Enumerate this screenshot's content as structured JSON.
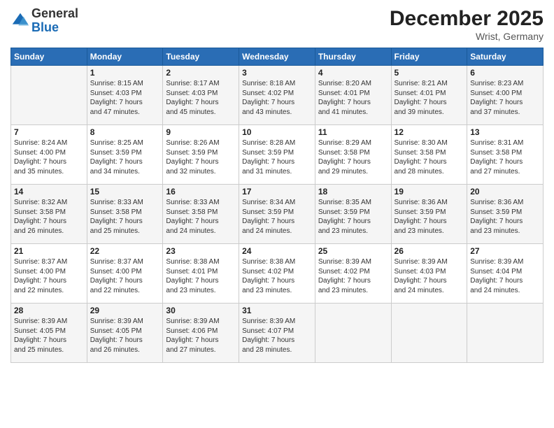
{
  "header": {
    "logo": {
      "general": "General",
      "blue": "Blue"
    },
    "title": "December 2025",
    "location": "Wrist, Germany"
  },
  "weekdays": [
    "Sunday",
    "Monday",
    "Tuesday",
    "Wednesday",
    "Thursday",
    "Friday",
    "Saturday"
  ],
  "weeks": [
    [
      {
        "day": "",
        "info": ""
      },
      {
        "day": "1",
        "info": "Sunrise: 8:15 AM\nSunset: 4:03 PM\nDaylight: 7 hours\nand 47 minutes."
      },
      {
        "day": "2",
        "info": "Sunrise: 8:17 AM\nSunset: 4:03 PM\nDaylight: 7 hours\nand 45 minutes."
      },
      {
        "day": "3",
        "info": "Sunrise: 8:18 AM\nSunset: 4:02 PM\nDaylight: 7 hours\nand 43 minutes."
      },
      {
        "day": "4",
        "info": "Sunrise: 8:20 AM\nSunset: 4:01 PM\nDaylight: 7 hours\nand 41 minutes."
      },
      {
        "day": "5",
        "info": "Sunrise: 8:21 AM\nSunset: 4:01 PM\nDaylight: 7 hours\nand 39 minutes."
      },
      {
        "day": "6",
        "info": "Sunrise: 8:23 AM\nSunset: 4:00 PM\nDaylight: 7 hours\nand 37 minutes."
      }
    ],
    [
      {
        "day": "7",
        "info": "Sunrise: 8:24 AM\nSunset: 4:00 PM\nDaylight: 7 hours\nand 35 minutes."
      },
      {
        "day": "8",
        "info": "Sunrise: 8:25 AM\nSunset: 3:59 PM\nDaylight: 7 hours\nand 34 minutes."
      },
      {
        "day": "9",
        "info": "Sunrise: 8:26 AM\nSunset: 3:59 PM\nDaylight: 7 hours\nand 32 minutes."
      },
      {
        "day": "10",
        "info": "Sunrise: 8:28 AM\nSunset: 3:59 PM\nDaylight: 7 hours\nand 31 minutes."
      },
      {
        "day": "11",
        "info": "Sunrise: 8:29 AM\nSunset: 3:58 PM\nDaylight: 7 hours\nand 29 minutes."
      },
      {
        "day": "12",
        "info": "Sunrise: 8:30 AM\nSunset: 3:58 PM\nDaylight: 7 hours\nand 28 minutes."
      },
      {
        "day": "13",
        "info": "Sunrise: 8:31 AM\nSunset: 3:58 PM\nDaylight: 7 hours\nand 27 minutes."
      }
    ],
    [
      {
        "day": "14",
        "info": "Sunrise: 8:32 AM\nSunset: 3:58 PM\nDaylight: 7 hours\nand 26 minutes."
      },
      {
        "day": "15",
        "info": "Sunrise: 8:33 AM\nSunset: 3:58 PM\nDaylight: 7 hours\nand 25 minutes."
      },
      {
        "day": "16",
        "info": "Sunrise: 8:33 AM\nSunset: 3:58 PM\nDaylight: 7 hours\nand 24 minutes."
      },
      {
        "day": "17",
        "info": "Sunrise: 8:34 AM\nSunset: 3:59 PM\nDaylight: 7 hours\nand 24 minutes."
      },
      {
        "day": "18",
        "info": "Sunrise: 8:35 AM\nSunset: 3:59 PM\nDaylight: 7 hours\nand 23 minutes."
      },
      {
        "day": "19",
        "info": "Sunrise: 8:36 AM\nSunset: 3:59 PM\nDaylight: 7 hours\nand 23 minutes."
      },
      {
        "day": "20",
        "info": "Sunrise: 8:36 AM\nSunset: 3:59 PM\nDaylight: 7 hours\nand 23 minutes."
      }
    ],
    [
      {
        "day": "21",
        "info": "Sunrise: 8:37 AM\nSunset: 4:00 PM\nDaylight: 7 hours\nand 22 minutes."
      },
      {
        "day": "22",
        "info": "Sunrise: 8:37 AM\nSunset: 4:00 PM\nDaylight: 7 hours\nand 22 minutes."
      },
      {
        "day": "23",
        "info": "Sunrise: 8:38 AM\nSunset: 4:01 PM\nDaylight: 7 hours\nand 23 minutes."
      },
      {
        "day": "24",
        "info": "Sunrise: 8:38 AM\nSunset: 4:02 PM\nDaylight: 7 hours\nand 23 minutes."
      },
      {
        "day": "25",
        "info": "Sunrise: 8:39 AM\nSunset: 4:02 PM\nDaylight: 7 hours\nand 23 minutes."
      },
      {
        "day": "26",
        "info": "Sunrise: 8:39 AM\nSunset: 4:03 PM\nDaylight: 7 hours\nand 24 minutes."
      },
      {
        "day": "27",
        "info": "Sunrise: 8:39 AM\nSunset: 4:04 PM\nDaylight: 7 hours\nand 24 minutes."
      }
    ],
    [
      {
        "day": "28",
        "info": "Sunrise: 8:39 AM\nSunset: 4:05 PM\nDaylight: 7 hours\nand 25 minutes."
      },
      {
        "day": "29",
        "info": "Sunrise: 8:39 AM\nSunset: 4:05 PM\nDaylight: 7 hours\nand 26 minutes."
      },
      {
        "day": "30",
        "info": "Sunrise: 8:39 AM\nSunset: 4:06 PM\nDaylight: 7 hours\nand 27 minutes."
      },
      {
        "day": "31",
        "info": "Sunrise: 8:39 AM\nSunset: 4:07 PM\nDaylight: 7 hours\nand 28 minutes."
      },
      {
        "day": "",
        "info": ""
      },
      {
        "day": "",
        "info": ""
      },
      {
        "day": "",
        "info": ""
      }
    ]
  ]
}
